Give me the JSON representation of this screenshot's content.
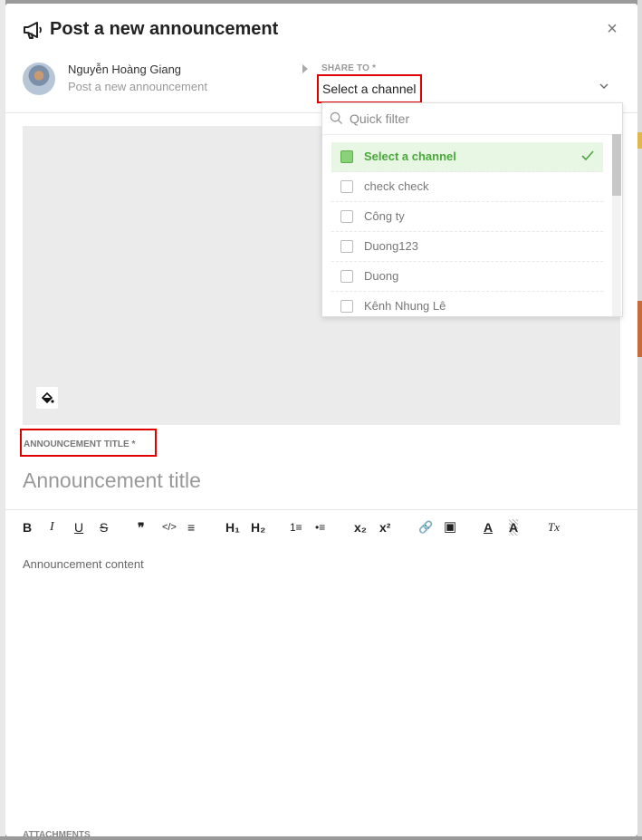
{
  "modal": {
    "title": "Post a new announcement",
    "close_label": "×"
  },
  "author": {
    "name": "Nguyễn Hoàng Giang",
    "subtitle": "Post a new announcement"
  },
  "share": {
    "label": "SHARE TO *",
    "selected": "Select a channel"
  },
  "dropdown": {
    "filter_placeholder": "Quick filter",
    "items": [
      {
        "label": "Select a channel",
        "selected": true
      },
      {
        "label": "check check",
        "selected": false
      },
      {
        "label": "Công ty",
        "selected": false
      },
      {
        "label": "Duong123",
        "selected": false
      },
      {
        "label": "Duong",
        "selected": false
      },
      {
        "label": "Kênh Nhung Lê",
        "selected": false
      }
    ]
  },
  "form": {
    "title_label": "ANNOUNCEMENT TITLE *",
    "title_placeholder": "Announcement title",
    "content_placeholder": "Announcement content",
    "attachments_label": "ATTACHMENTS"
  },
  "toolbar": {
    "bold": "B",
    "italic": "I",
    "underline": "U",
    "strike": "S",
    "quote": "❞",
    "code": "</>",
    "align": "≡",
    "h1": "H₁",
    "h2": "H₂",
    "ordered_list": "1≡",
    "bullet_list": "•≡",
    "subscript": "x₂",
    "superscript": "x²",
    "link": "🔗",
    "image": "▣",
    "text_color": "A",
    "highlight": "A",
    "clear_format": "Tx"
  },
  "colors": {
    "accent_green": "#4aa83a",
    "highlight_red": "#e00000"
  }
}
